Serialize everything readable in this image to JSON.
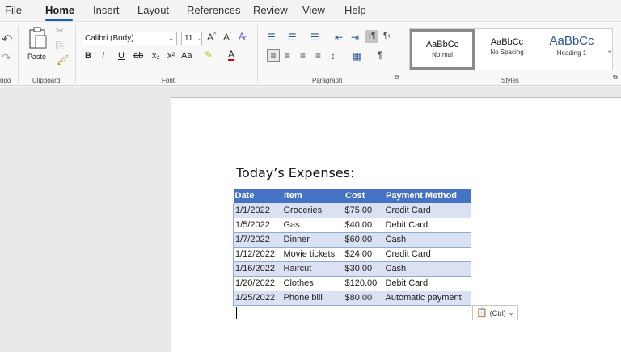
{
  "menu": {
    "items": [
      "File",
      "Home",
      "Insert",
      "Layout",
      "References",
      "Review",
      "View",
      "Help"
    ],
    "active": "Home"
  },
  "ribbon": {
    "undo": {
      "label": "ndo"
    },
    "clipboard": {
      "paste_label": "Paste",
      "group_label": "Clipboard"
    },
    "font": {
      "font_name": "Calibri (Body)",
      "font_size": "11",
      "group_label": "Font",
      "buttons": [
        "B",
        "I",
        "U",
        "ab",
        "x₂",
        "x²",
        "Aa"
      ]
    },
    "paragraph": {
      "group_label": "Paragraph",
      "pilcrow": "¶"
    },
    "styles": {
      "group_label": "Styles",
      "tiles": [
        {
          "sample": "AaBbCc",
          "name": "Normal"
        },
        {
          "sample": "AaBbCc",
          "name": "No Spacing"
        },
        {
          "sample": "AaBbCc",
          "name": "Heading 1"
        }
      ]
    }
  },
  "document": {
    "title": "Today’s Expenses:",
    "table": {
      "headers": [
        "Date",
        "Item",
        "Cost",
        "Payment Method"
      ],
      "rows": [
        [
          "1/1/2022",
          "Groceries",
          "$75.00",
          "Credit Card"
        ],
        [
          "1/5/2022",
          "Gas",
          "$40.00",
          "Debit Card"
        ],
        [
          "1/7/2022",
          "Dinner",
          "$60.00",
          "Cash"
        ],
        [
          "1/12/2022",
          "Movie tickets",
          "$24.00",
          "Credit Card"
        ],
        [
          "1/16/2022",
          "Haircut",
          "$30.00",
          "Cash"
        ],
        [
          "1/20/2022",
          "Clothes",
          "$120.00",
          "Debit Card"
        ],
        [
          "1/25/2022",
          "Phone bill",
          "$80.00",
          "Automatic payment"
        ]
      ]
    },
    "paste_options_label": "(Ctrl)"
  }
}
